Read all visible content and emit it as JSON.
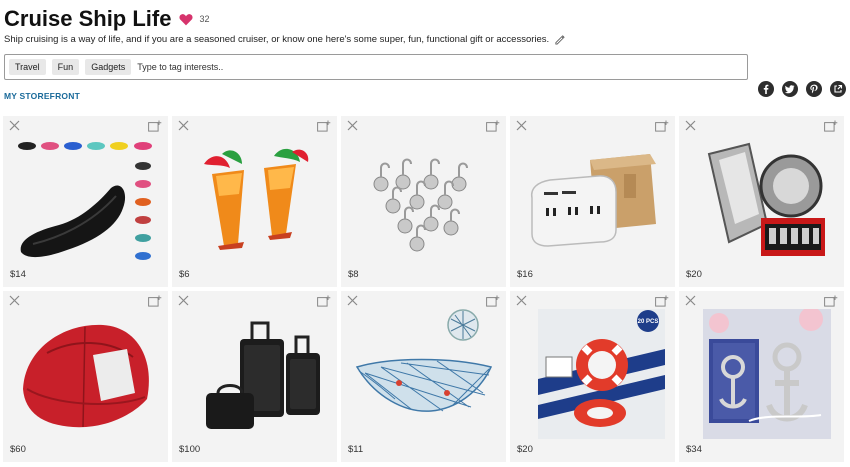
{
  "header": {
    "title": "Cruise Ship Life",
    "likes_count": "32",
    "heart_icon": "heart-icon",
    "heart_color": "#d6336c",
    "description": "Ship cruising is a way of life, and if you are a seasoned cruiser, or know one here's some super, fun, functional gift or accessories.",
    "edit_icon": "pencil-icon"
  },
  "tags": {
    "items": [
      "Travel",
      "Fun",
      "Gadgets"
    ],
    "placeholder": "Type to tag interests.."
  },
  "storefront": {
    "label": "MY STOREFRONT",
    "color": "#1a6a9a"
  },
  "share": {
    "icons": [
      "facebook-icon",
      "twitter-icon",
      "pinterest-icon",
      "share-link-icon"
    ]
  },
  "products": [
    {
      "price": "$14",
      "image": "water-shoes"
    },
    {
      "price": "$6",
      "image": "tropical-cups"
    },
    {
      "price": "$8",
      "image": "magnetic-hooks"
    },
    {
      "price": "$16",
      "image": "outlet-power-strip"
    },
    {
      "price": "$20",
      "image": "towel-clips"
    },
    {
      "price": "$60",
      "image": "beach-umbrella"
    },
    {
      "price": "$100",
      "image": "luggage-set"
    },
    {
      "price": "$11",
      "image": "fishing-net-decor"
    },
    {
      "price": "$20",
      "image": "life-ring-favors"
    },
    {
      "price": "$34",
      "image": "anchor-bottle-opener"
    }
  ],
  "badges": {
    "pcs_badge": "20 PCS"
  }
}
